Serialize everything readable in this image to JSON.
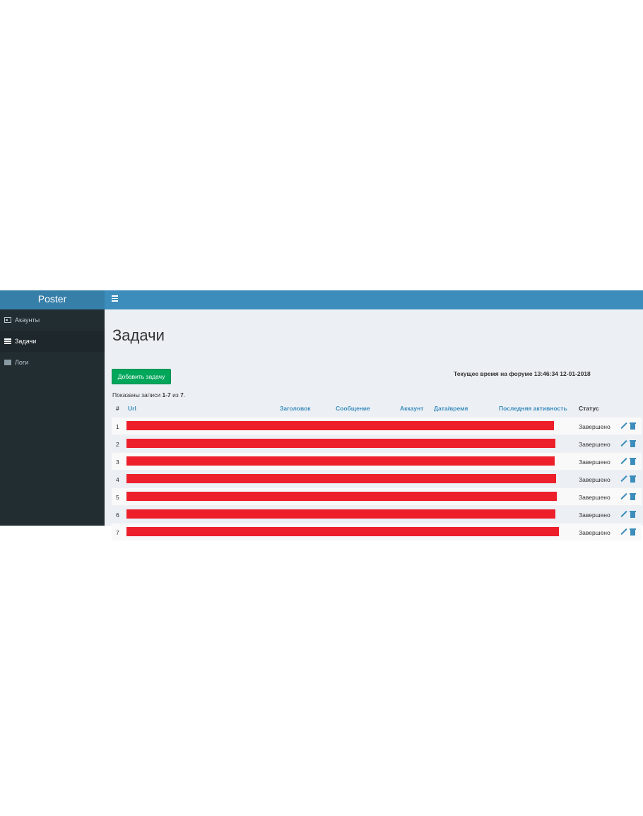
{
  "app": {
    "brand": "Poster"
  },
  "sidebar": {
    "items": [
      {
        "label": "Акаунты",
        "icon": "id-card-icon",
        "active": false
      },
      {
        "label": "Задачи",
        "icon": "tasks-icon",
        "active": true
      },
      {
        "label": "Логи",
        "icon": "book-icon",
        "active": false
      }
    ]
  },
  "header": {
    "menu_icon": "hamburger-icon"
  },
  "page": {
    "title": "Задачи",
    "add_button": "Добавить задачу",
    "time_info": "Текущее время на форуме 13:46:34 12-01-2018",
    "summary": {
      "prefix": "Показаны записи ",
      "range": "1-7",
      "middle": " из ",
      "total": "7",
      "suffix": "."
    }
  },
  "table": {
    "columns": [
      "#",
      "Url",
      "Заголовок",
      "Сообщение",
      "Аккаунт",
      "Дата/время",
      "Последняя активность",
      "Статус"
    ],
    "rows": [
      {
        "num": "1",
        "status": "Завершено"
      },
      {
        "num": "2",
        "status": "Завершено"
      },
      {
        "num": "3",
        "status": "Завершено"
      },
      {
        "num": "4",
        "status": "Завершено"
      },
      {
        "num": "5",
        "status": "Завершено"
      },
      {
        "num": "6",
        "status": "Завершено"
      },
      {
        "num": "7",
        "status": "Завершено"
      }
    ]
  },
  "colors": {
    "sidebar_bg": "#222d32",
    "header_bg": "#3c8dbc",
    "brand_bg": "#367fa9",
    "button_green": "#00a65a",
    "redaction": "#ec1f2b"
  }
}
